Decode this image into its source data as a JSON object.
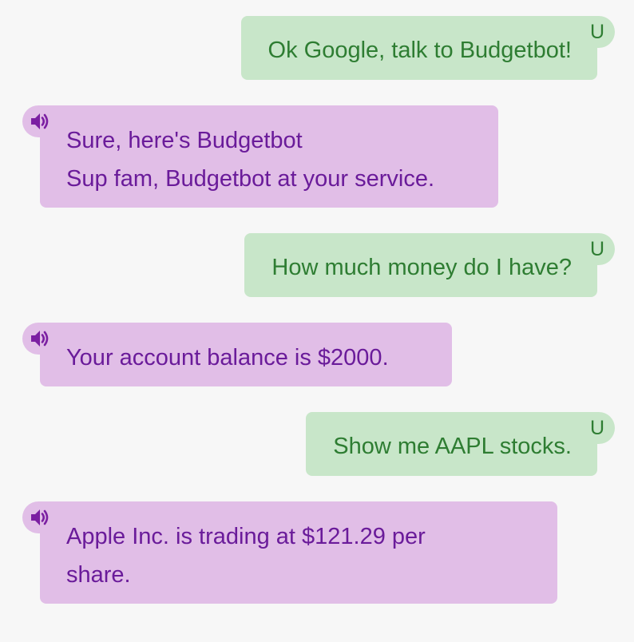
{
  "colors": {
    "background": "#f7f7f7",
    "user_bubble": "#c8e6c9",
    "user_text": "#2e7d32",
    "bot_bubble": "#e1bee7",
    "bot_text": "#6a1b9a"
  },
  "conversation": {
    "messages": [
      {
        "sender": "user",
        "badge": "U",
        "text": "Ok Google, talk to Budgetbot!"
      },
      {
        "sender": "bot",
        "icon": "speaker-icon",
        "lines": [
          "Sure, here's Budgetbot",
          "Sup fam, Budgetbot at your service."
        ]
      },
      {
        "sender": "user",
        "badge": "U",
        "text": "How much money do I have?"
      },
      {
        "sender": "bot",
        "icon": "speaker-icon",
        "lines": [
          "Your account balance is $2000."
        ]
      },
      {
        "sender": "user",
        "badge": "U",
        "text": "Show me AAPL stocks."
      },
      {
        "sender": "bot",
        "icon": "speaker-icon",
        "lines": [
          "Apple Inc. is trading at $121.29 per",
          "share."
        ]
      }
    ]
  }
}
